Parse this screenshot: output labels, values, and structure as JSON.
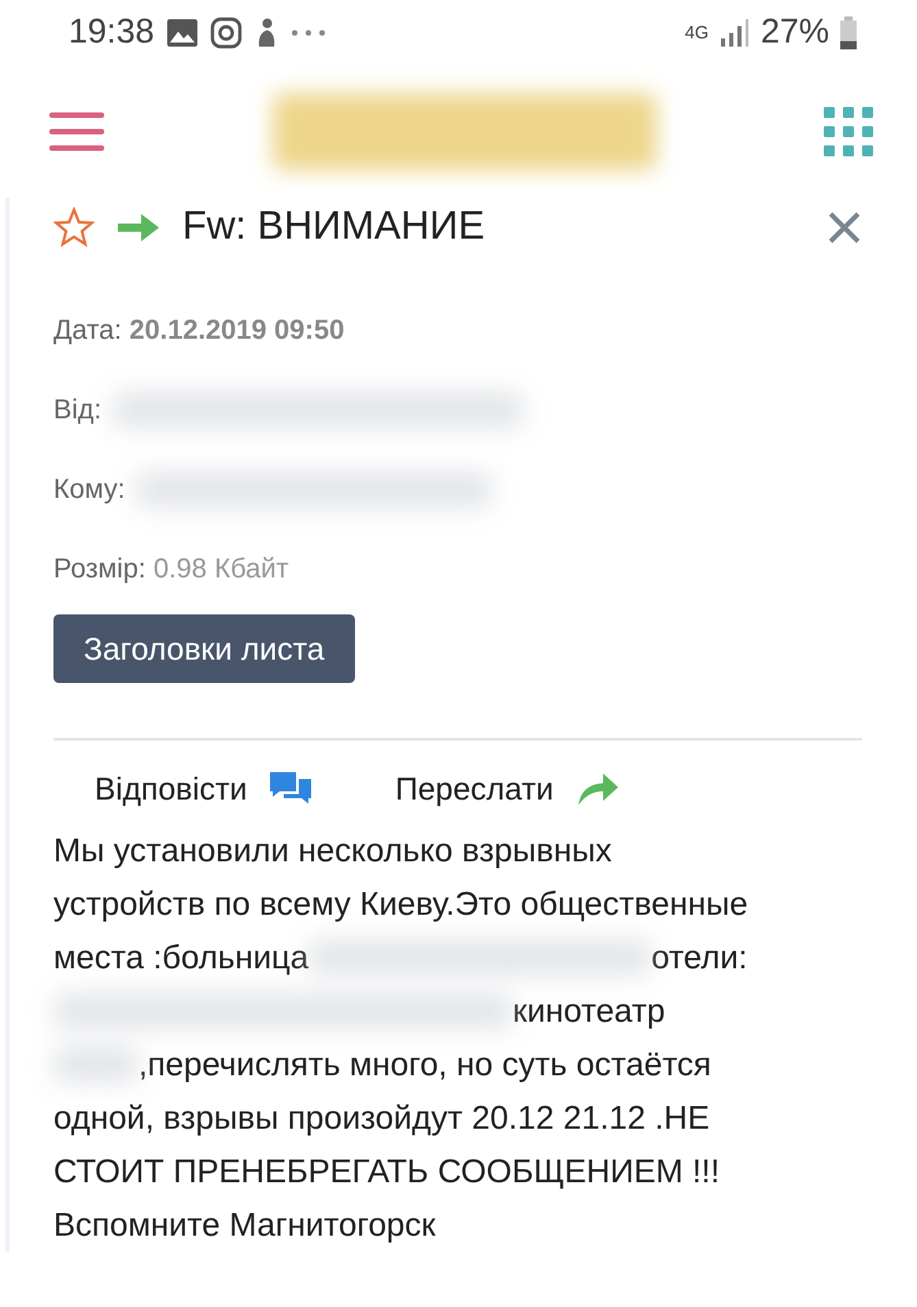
{
  "status_bar": {
    "time": "19:38",
    "network": "4G",
    "battery": "27%"
  },
  "app_bar": {
    "logo": {
      "kind": "redacted"
    }
  },
  "message": {
    "starred": false,
    "forwarded": true,
    "subject": "Fw: ВНИМАНИЕ",
    "fields": [
      {
        "label": "Дата:",
        "value": "20.12.2019 09:50",
        "redacted": false
      },
      {
        "label": "Від:",
        "redacted": true
      },
      {
        "label": "Кому:",
        "redacted": true
      },
      {
        "label": "Розмір:",
        "value": "0.98 Кбайт",
        "redacted": false
      }
    ],
    "headers_button": "Заголовки листа",
    "actions": [
      {
        "kind": "reply",
        "label": "Відповісти"
      },
      {
        "kind": "forward",
        "label": "Переслати"
      }
    ],
    "body": [
      [
        {
          "kind": "text",
          "text": "Мы установили несколько взрывных"
        }
      ],
      [
        {
          "kind": "text",
          "text": "устройств по всему Киеву.Это общественные"
        }
      ],
      [
        {
          "kind": "text",
          "text": "места :больница"
        },
        {
          "kind": "redacted"
        },
        {
          "kind": "text",
          "text": "отели:"
        }
      ],
      [
        {
          "kind": "redacted"
        },
        {
          "kind": "text",
          "text": "кинотеатр"
        }
      ],
      [
        {
          "kind": "redacted_short"
        },
        {
          "kind": "text",
          "text": ",перечислять много, но суть остаётся"
        }
      ],
      [
        {
          "kind": "text",
          "text": "одной, взрывы произойдут 20.12 21.12 .НЕ"
        }
      ],
      [
        {
          "kind": "text",
          "text": "СТОИТ ПРЕНЕБРЕГАТЬ СООБЩЕНИЕМ !!!"
        }
      ],
      [
        {
          "kind": "text",
          "text": "Вспомните Магнитогорск"
        }
      ]
    ]
  }
}
